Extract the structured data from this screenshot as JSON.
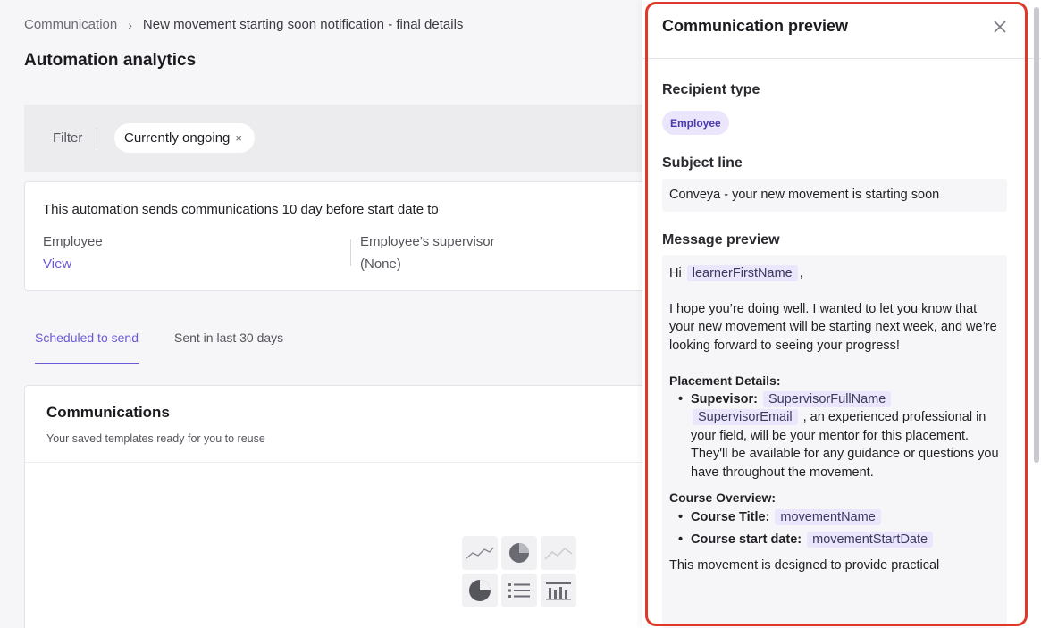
{
  "breadcrumb": {
    "parent": "Communication",
    "separator": "›",
    "current": "New movement starting soon notification - final details"
  },
  "page_title": "Automation analytics",
  "filter": {
    "label": "Filter",
    "chip_label": "Currently ongoing",
    "chip_remove": "×"
  },
  "info": {
    "description": "This automation sends communications 10 day before start date to",
    "col1_label": "Employee",
    "col1_link": "View",
    "col2_label": "Employee’s supervisor",
    "col2_value": "(None)"
  },
  "tabs": [
    {
      "label": "Scheduled to send",
      "active": true
    },
    {
      "label": "Sent in last 30 days",
      "active": false
    }
  ],
  "communications": {
    "title": "Communications",
    "subtitle": "Your saved templates ready for you to reuse",
    "empty_icons": [
      "line-chart-icon",
      "pie-chart-icon",
      "area-chart-icon",
      "donut-chart-icon",
      "list-icon",
      "bar-chart-icon"
    ]
  },
  "drawer": {
    "title": "Communication preview",
    "close_icon": "close-icon",
    "recipient_label": "Recipient type",
    "recipient_value": "Employee",
    "subject_label": "Subject line",
    "subject_value": "Conveya - your new movement is starting soon",
    "message_label": "Message preview",
    "message": {
      "greeting": "Hi",
      "greeting_tag": "learnerFirstName",
      "greeting_end": ",",
      "intro": "I hope you’re doing well. I wanted to let you know that your new movement will be starting next week, and we’re looking forward to seeing your progress!",
      "placement_heading": "Placement Details:",
      "supervisor_label": "Supevisor:",
      "supervisor_tag1": "SupervisorFullName",
      "supervisor_tag2": "SupervisorEmail",
      "supervisor_text": ", an experienced professional in your field, will be your mentor for this placement. They'll be available for any guidance or questions you have throughout the movement.",
      "course_heading": "Course Overview:",
      "course_title_label": "Course Title:",
      "course_title_tag": "movementName",
      "course_date_label": "Course start date:",
      "course_date_tag": "movementStartDate",
      "closing": "This movement is designed to provide practical"
    }
  },
  "colors": {
    "accent": "#6b5ad6",
    "highlight_outline": "#e0382b",
    "badge_bg": "#ebe6fb"
  }
}
